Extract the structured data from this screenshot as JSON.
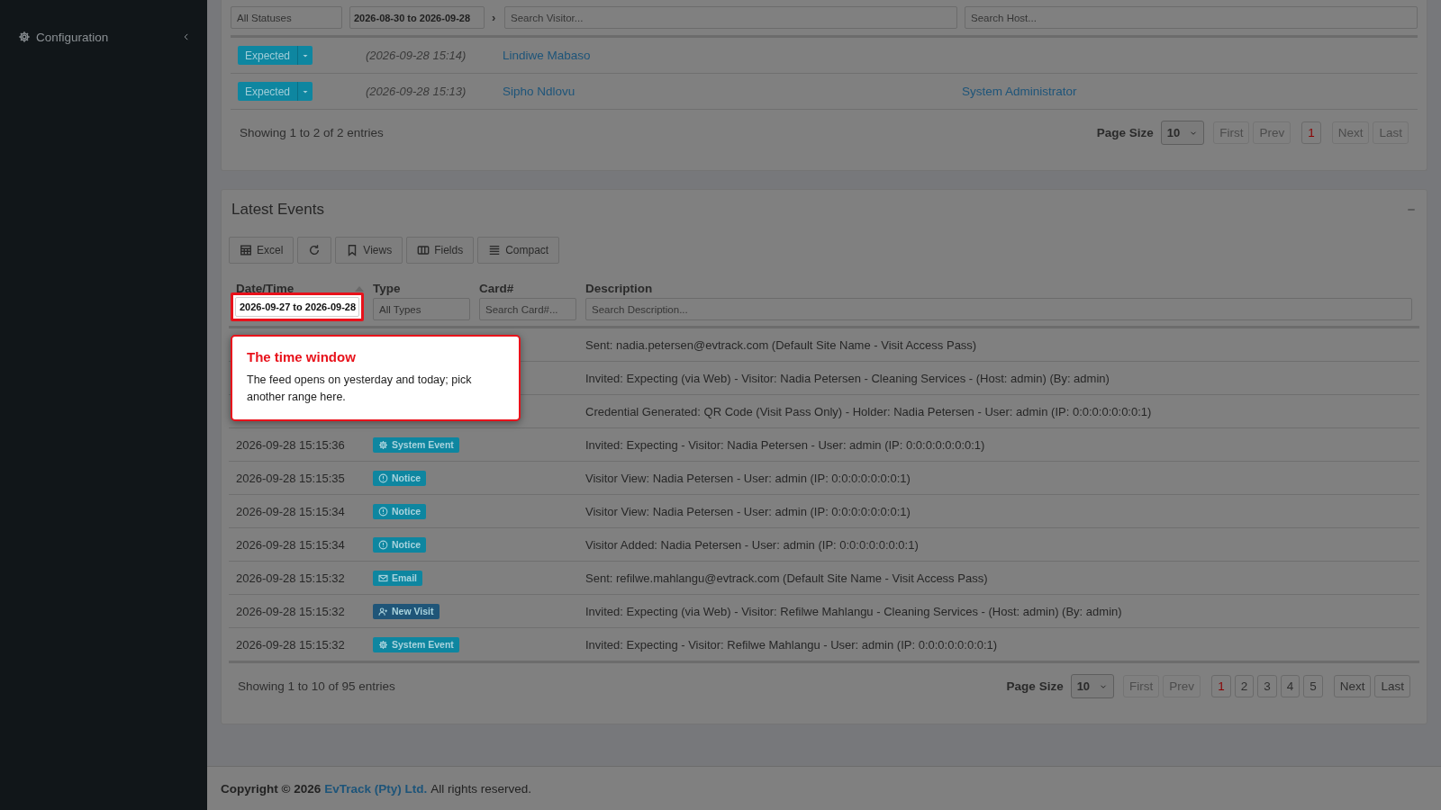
{
  "sidebar": {
    "items": [
      {
        "label": "Configuration",
        "expanded": false
      }
    ]
  },
  "visits": {
    "filters": {
      "status": "All Statuses",
      "date_range": "2026-08-30 to 2026-09-28",
      "range_arrow": "›",
      "visitor_placeholder": "Search Visitor...",
      "host_placeholder": "Search Host..."
    },
    "rows": [
      {
        "status": "Expected",
        "time": "(2026-09-28 15:14)",
        "visitor": "Lindiwe Mabaso"
      },
      {
        "status": "Expected",
        "time": "(2026-09-28 15:13)",
        "visitor": "Sipho Ndlovu",
        "host": "System Administrator"
      }
    ],
    "info": "Showing 1 to 2 of 2 entries",
    "pager": {
      "page_size_label": "Page Size",
      "page_size": "10",
      "first": {
        "label": "First",
        "disabled": true
      },
      "prev": {
        "label": "Prev",
        "disabled": true
      },
      "pages": [
        {
          "label": "1",
          "selected": true
        }
      ],
      "next": {
        "label": "Next",
        "disabled": true
      },
      "last": {
        "label": "Last",
        "disabled": true
      }
    }
  },
  "events": {
    "title": "Latest Events",
    "toolbar": [
      {
        "kind": "excel",
        "label": "Excel"
      },
      {
        "kind": "refresh"
      },
      {
        "kind": "views",
        "label": "Views"
      },
      {
        "kind": "fields",
        "label": "Fields"
      },
      {
        "kind": "compact",
        "label": "Compact"
      }
    ],
    "columns": [
      {
        "label": "Date/Time",
        "sorted": true
      },
      {
        "label": "Type",
        "sorted": false
      },
      {
        "label": "Card#",
        "sorted": false
      },
      {
        "label": "Description",
        "sorted": false
      }
    ],
    "filters": {
      "date_range": "2026-09-27 to 2026-09-28",
      "type": "All Types",
      "card_placeholder": "Search Card#...",
      "description_placeholder": "Search Description..."
    },
    "rows": [
      {
        "description": "Sent: nadia.petersen@evtrack.com (Default Site Name - Visit Access Pass)"
      },
      {
        "description": "Invited: Expecting (via Web) - Visitor: Nadia Petersen - Cleaning Services - (Host: admin) (By: admin)"
      },
      {
        "description": "Credential Generated: QR Code (Visit Pass Only) - Holder: Nadia Petersen - User: admin (IP: 0:0:0:0:0:0:0:1)"
      },
      {
        "datetime": "2026-09-28 15:15:36",
        "type": {
          "kind": "system",
          "label": "System Event",
          "color": "#0e86a0"
        },
        "description": "Invited: Expecting - Visitor: Nadia Petersen - User: admin (IP: 0:0:0:0:0:0:0:1)"
      },
      {
        "datetime": "2026-09-28 15:15:35",
        "type": {
          "kind": "notice",
          "label": "Notice",
          "color": "#0e86a0"
        },
        "description": "Visitor View: Nadia Petersen - User: admin (IP: 0:0:0:0:0:0:0:1)"
      },
      {
        "datetime": "2026-09-28 15:15:34",
        "type": {
          "kind": "notice",
          "label": "Notice",
          "color": "#0e86a0"
        },
        "description": "Visitor View: Nadia Petersen - User: admin (IP: 0:0:0:0:0:0:0:1)"
      },
      {
        "datetime": "2026-09-28 15:15:34",
        "type": {
          "kind": "notice",
          "label": "Notice",
          "color": "#0e86a0"
        },
        "description": "Visitor Added: Nadia Petersen - User: admin (IP: 0:0:0:0:0:0:0:1)"
      },
      {
        "datetime": "2026-09-28 15:15:32",
        "type": {
          "kind": "email",
          "label": "Email",
          "color": "#0e86a0"
        },
        "description": "Sent: refilwe.mahlangu@evtrack.com (Default Site Name - Visit Access Pass)"
      },
      {
        "datetime": "2026-09-28 15:15:32",
        "type": {
          "kind": "visit",
          "label": "New Visit",
          "color": "#1f5578"
        },
        "description": "Invited: Expecting (via Web) - Visitor: Refilwe Mahlangu - Cleaning Services - (Host: admin) (By: admin)"
      },
      {
        "datetime": "2026-09-28 15:15:32",
        "type": {
          "kind": "system",
          "label": "System Event",
          "color": "#0e86a0"
        },
        "description": "Invited: Expecting - Visitor: Refilwe Mahlangu - User: admin (IP: 0:0:0:0:0:0:0:1)"
      }
    ],
    "info": "Showing 1 to 10 of 95 entries",
    "pager": {
      "page_size_label": "Page Size",
      "page_size": "10",
      "first": {
        "label": "First",
        "disabled": true
      },
      "prev": {
        "label": "Prev",
        "disabled": true
      },
      "pages": [
        {
          "label": "1",
          "selected": true
        },
        {
          "label": "2",
          "selected": false
        },
        {
          "label": "3",
          "selected": false
        },
        {
          "label": "4",
          "selected": false
        },
        {
          "label": "5",
          "selected": false
        }
      ],
      "next": {
        "label": "Next",
        "disabled": false
      },
      "last": {
        "label": "Last",
        "disabled": false
      }
    }
  },
  "tour": {
    "title": "The time window",
    "text": "The feed opens on yesterday and today; pick another range here."
  },
  "footer": {
    "copyright": "Copyright © 2026",
    "company": "EvTrack (Pty) Ltd.",
    "rights": "All rights reserved."
  }
}
